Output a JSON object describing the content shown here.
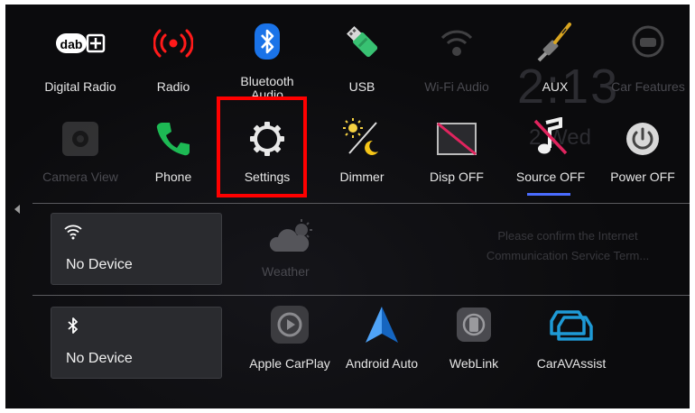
{
  "background": {
    "clock_text": "2:13",
    "date_text": "2 Wed",
    "notice_text": "Please confirm the Internet Communication Service Term..."
  },
  "top_row": [
    {
      "label": "Digital Radio",
      "icon": "dab-icon"
    },
    {
      "label": "Radio",
      "icon": "radio-waves-icon"
    },
    {
      "label": "Bluetooth Audio",
      "icon": "bluetooth-icon"
    },
    {
      "label": "USB",
      "icon": "usb-stick-icon"
    },
    {
      "label": "Wi-Fi Audio",
      "icon": "wifi-audio-icon",
      "disabled": true
    },
    {
      "label": "AUX",
      "icon": "aux-cable-icon"
    },
    {
      "label": "Car Features",
      "icon": "car-features-icon",
      "disabled": true
    }
  ],
  "second_row": [
    {
      "label": "Camera View",
      "icon": "camera-icon",
      "disabled": true
    },
    {
      "label": "Phone",
      "icon": "phone-icon"
    },
    {
      "label": "Settings",
      "icon": "gear-icon",
      "highlighted": true
    },
    {
      "label": "Dimmer",
      "icon": "dimmer-icon"
    },
    {
      "label": "Disp OFF",
      "icon": "display-off-icon"
    },
    {
      "label": "Source OFF",
      "icon": "music-off-icon",
      "selected": true
    },
    {
      "label": "Power OFF",
      "icon": "power-icon"
    }
  ],
  "widgets": {
    "wifi_device": "No Device",
    "weather_label": "Weather",
    "bt_device": "No Device"
  },
  "apps": [
    {
      "label": "Apple CarPlay",
      "icon": "carplay-icon"
    },
    {
      "label": "Android Auto",
      "icon": "android-auto-icon"
    },
    {
      "label": "WebLink",
      "icon": "weblink-icon"
    },
    {
      "label": "CarAVAssist",
      "icon": "caravassist-icon"
    }
  ],
  "colors": {
    "highlight": "#ff0000",
    "accent_underline": "#4a6cff",
    "bluetooth_blue": "#1a73e8",
    "radio_red": "#ff1a1a",
    "phone_green": "#1db954",
    "caravassist_blue": "#1e9ad6"
  }
}
